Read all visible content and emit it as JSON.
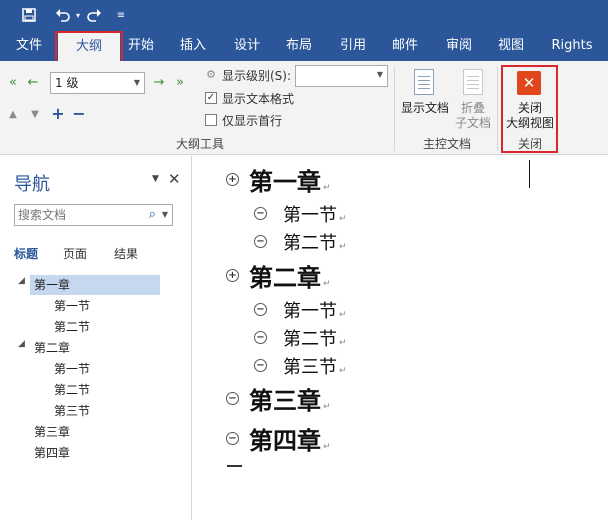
{
  "tabs": [
    {
      "label": "文件"
    },
    {
      "label": "大纲"
    },
    {
      "label": "开始"
    },
    {
      "label": "插入"
    },
    {
      "label": "设计"
    },
    {
      "label": "布局"
    },
    {
      "label": "引用"
    },
    {
      "label": "邮件"
    },
    {
      "label": "审阅"
    },
    {
      "label": "视图"
    },
    {
      "label": "Rights"
    }
  ],
  "outline_tools": {
    "level_value": "1 级",
    "show_level_label": "显示级别(S):",
    "show_level_value": "",
    "show_text_format_label": "显示文本格式",
    "show_text_format_checked": true,
    "show_first_line_label": "仅显示首行",
    "show_first_line_checked": false,
    "group_label": "大纲工具"
  },
  "master_doc": {
    "show_doc_label": "显示文档",
    "collapse_sub_label_1": "折叠",
    "collapse_sub_label_2": "子文档",
    "group_label": "主控文档"
  },
  "close_group": {
    "button_label_1": "关闭",
    "button_label_2": "大纲视图",
    "group_label": "关闭"
  },
  "nav_pane": {
    "title": "导航",
    "search_placeholder": "搜索文档",
    "tabs": [
      {
        "label": "标题"
      },
      {
        "label": "页面"
      },
      {
        "label": "结果"
      }
    ],
    "tree": [
      {
        "label": "第一章"
      },
      {
        "label": "第一节"
      },
      {
        "label": "第二节"
      },
      {
        "label": "第二章"
      },
      {
        "label": "第一节"
      },
      {
        "label": "第二节"
      },
      {
        "label": "第三节"
      },
      {
        "label": "第三章"
      },
      {
        "label": "第四章"
      }
    ]
  },
  "document": {
    "items": [
      {
        "text": "第一章"
      },
      {
        "text": "第一节"
      },
      {
        "text": "第二节"
      },
      {
        "text": "第二章"
      },
      {
        "text": "第一节"
      },
      {
        "text": "第二节"
      },
      {
        "text": "第三节"
      },
      {
        "text": "第三章"
      },
      {
        "text": "第四章"
      }
    ]
  },
  "colors": {
    "brand": "#2b579a",
    "close_button": "#e0461c",
    "highlight_outline": "#d9272e",
    "selected_tree_bg": "#c6d8ef"
  }
}
